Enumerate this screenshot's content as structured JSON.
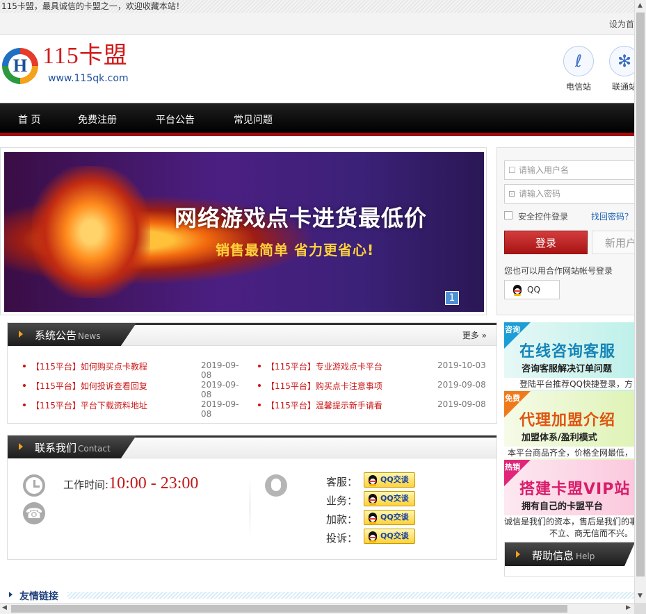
{
  "topbar": {
    "welcome": "115卡盟，最具诚信的卡盟之一，欢迎收藏本站！"
  },
  "strip": {
    "sethome": "设为首"
  },
  "logo": {
    "letter": "H",
    "brand": "115卡盟",
    "url": "www.115qk.com"
  },
  "stations": [
    {
      "label": "电信站",
      "icon": "telecom-icon"
    },
    {
      "label": "联通站",
      "icon": "unicom-icon"
    }
  ],
  "nav": [
    "首 页",
    "免费注册",
    "平台公告",
    "常见问题"
  ],
  "banner": {
    "title": "网络游戏点卡进货最低价",
    "subtitle": "销售最简单   省力更省心!",
    "page": "1"
  },
  "login": {
    "username_placeholder": "请输入用户名",
    "password_placeholder": "请输入密码",
    "secure_label": "安全控件登录",
    "forgot": "找回密码？",
    "login_button": "登录",
    "new_button": "新用户",
    "alt_login": "您也可以用合作网站帐号登录",
    "qq_button": "QQ"
  },
  "notice": {
    "title": "系统公告",
    "title_en": "News",
    "more": "更多",
    "items": [
      {
        "title": "【115平台】如何购买点卡教程",
        "date": "2019-09-08"
      },
      {
        "title": "【115平台】专业游戏点卡平台",
        "date": "2019-10-03"
      },
      {
        "title": "【115平台】如何投诉查看回复",
        "date": "2019-09-08"
      },
      {
        "title": "【115平台】购买点卡注意事项",
        "date": "2019-09-08"
      },
      {
        "title": "【115平台】平台下载资料地址",
        "date": "2019-09-08"
      },
      {
        "title": "【115平台】温馨提示新手请看",
        "date": "2019-09-08"
      }
    ]
  },
  "contact": {
    "title": "联系我们",
    "title_en": "Contact",
    "time_label": "工作时间:",
    "time_value": "10:00 - 23:00",
    "lines": [
      "客服：",
      "业务：",
      "加款：",
      "投诉："
    ],
    "qq_badge": "QQ交谈"
  },
  "ads": [
    {
      "tag": "咨询",
      "big": "在线咨询客服",
      "small": "咨询客服解决订单问题",
      "desc": "登陆平台推荐QQ快捷登录，方",
      "color": "#1585b8",
      "tag_color": "#1b9ed6"
    },
    {
      "tag": "免费",
      "big": "代理加盟介绍",
      "small": "加盟体系/盈利模式",
      "desc": "本平台商品齐全，价格全网最低，",
      "color": "#e05410",
      "tag_color": "#f07a1a"
    },
    {
      "tag": "热销",
      "big": "搭建卡盟VIP站",
      "small": "拥有自己的卡盟平台",
      "desc": "诚信是我们的资本，售后是我们的事",
      "color": "#d81d6a",
      "tag_color": "#e0267a"
    }
  ],
  "ad3_extra": "不立、商无信而不兴。",
  "help": {
    "title": "帮助信息",
    "title_en": "Help"
  },
  "friend": {
    "label": "友情链接"
  }
}
